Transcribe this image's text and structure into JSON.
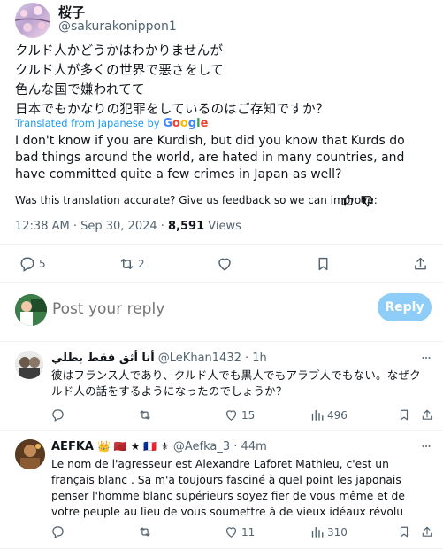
{
  "main_tweet": {
    "display_name": "桜子",
    "handle": "@sakurakonippon1",
    "original_lines": [
      "クルド人かどうかはわかりませんが",
      "クルド人が多くの世界で悪さをして",
      "色んな国で嫌われてて",
      "日本でもかなりの犯罪をしているのはご存知ですか？"
    ],
    "translated_from": "Translated from Japanese by",
    "translator": "Google",
    "translation": "I don't know if you are Kurdish, but did you know that Kurds do bad things around the world, are hated in many countries, and have committed quite a few crimes in Japan as well?",
    "feedback_prompt": "Was this translation accurate? Give us feedback so we can improve:",
    "timestamp": "12:38 AM · Sep 30, 2024 · ",
    "views_count": "8,591",
    "views_label": " Views",
    "actions": {
      "replies": "5",
      "reposts": "2"
    }
  },
  "composer": {
    "placeholder": "Post your reply",
    "button": "Reply"
  },
  "replies": [
    {
      "display_name": "أنا أثق فقط بطلي",
      "handle": "@LeKhan1432",
      "age": "· 1h",
      "text": "彼はフランス人であり、クルド人でも黒人でもアラブ人でもない。なぜクルド人の話をするようになったのでしょうか？",
      "likes": "15",
      "views": "496"
    },
    {
      "display_name": "AEFKA",
      "badges": "👑 🇲🇦 ★ 🇫🇷 ⚜",
      "handle": "@Aefka_3",
      "age": "· 44m",
      "text": "Le nom de l'agresseur est Alexandre Laforet Mathieu, c'est un français blanc . Sa m'a toujours fasciné à quel point les japonais penser l'homme blanc supérieurs soyez fier de vous même et de votre peuple au lieu de vous soumettre à de vieux idéaux révolu",
      "likes": "11",
      "views": "310"
    }
  ],
  "colors": {
    "accent": "#1d9bf0",
    "muted": "#536471",
    "reply_button": "#8ecdf8",
    "google_blue": "#4285f4",
    "google_red": "#ea4335",
    "google_yellow": "#fbbc05",
    "google_green": "#34a853"
  }
}
